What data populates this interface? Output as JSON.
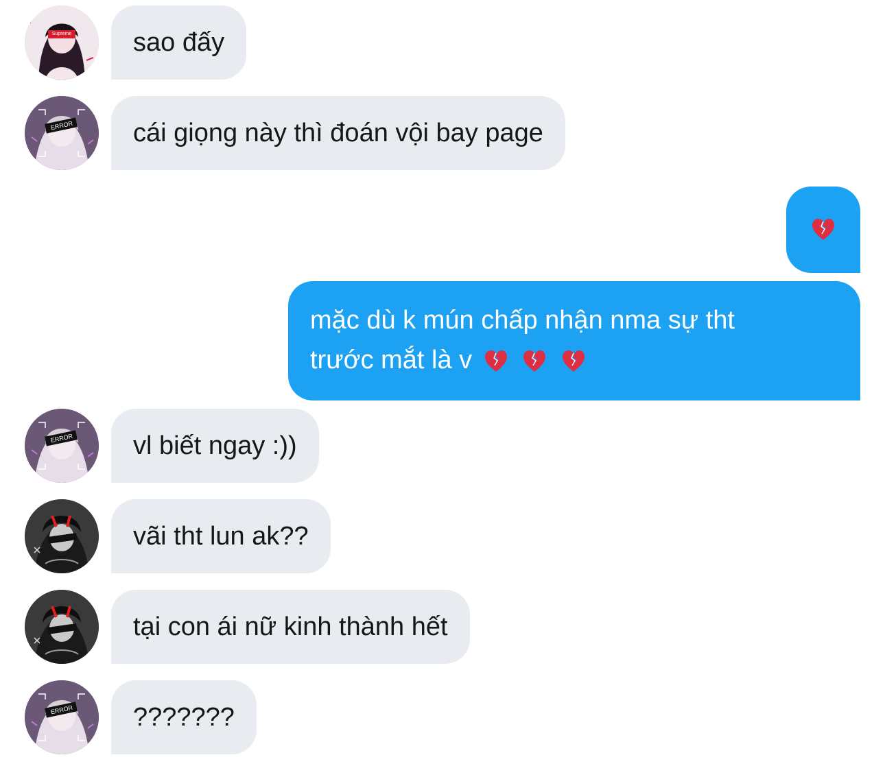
{
  "messages": [
    {
      "side": "in",
      "avatar": "supreme-girl-avatar",
      "text": "sao đấy"
    },
    {
      "side": "in",
      "avatar": "error-girl-avatar",
      "text": "cái giọng này thì đoán vội bay page"
    },
    {
      "side": "out",
      "text": "💔"
    },
    {
      "side": "out",
      "line1": "mặc dù k mún chấp nhận nma sự tht",
      "line2": "trước mắt là v",
      "emojis": "💔💔💔"
    },
    {
      "side": "in",
      "avatar": "error-girl-avatar",
      "text": "vl biết ngay :))"
    },
    {
      "side": "in",
      "avatar": "dark-boy-avatar",
      "text": "vãi tht lun ak??"
    },
    {
      "side": "in",
      "avatar": "dark-boy-avatar",
      "text": "tại con ái nữ kinh thành hết"
    },
    {
      "side": "in",
      "avatar": "error-girl-avatar",
      "text": "???????"
    }
  ],
  "avatar_badges": {
    "supreme": "Supreme",
    "error": "ERROR"
  },
  "colors": {
    "incoming_bubble": "#e8ecf0",
    "outgoing_bubble": "#1da1f2",
    "incoming_text": "#14171a",
    "outgoing_text": "#ffffff"
  }
}
